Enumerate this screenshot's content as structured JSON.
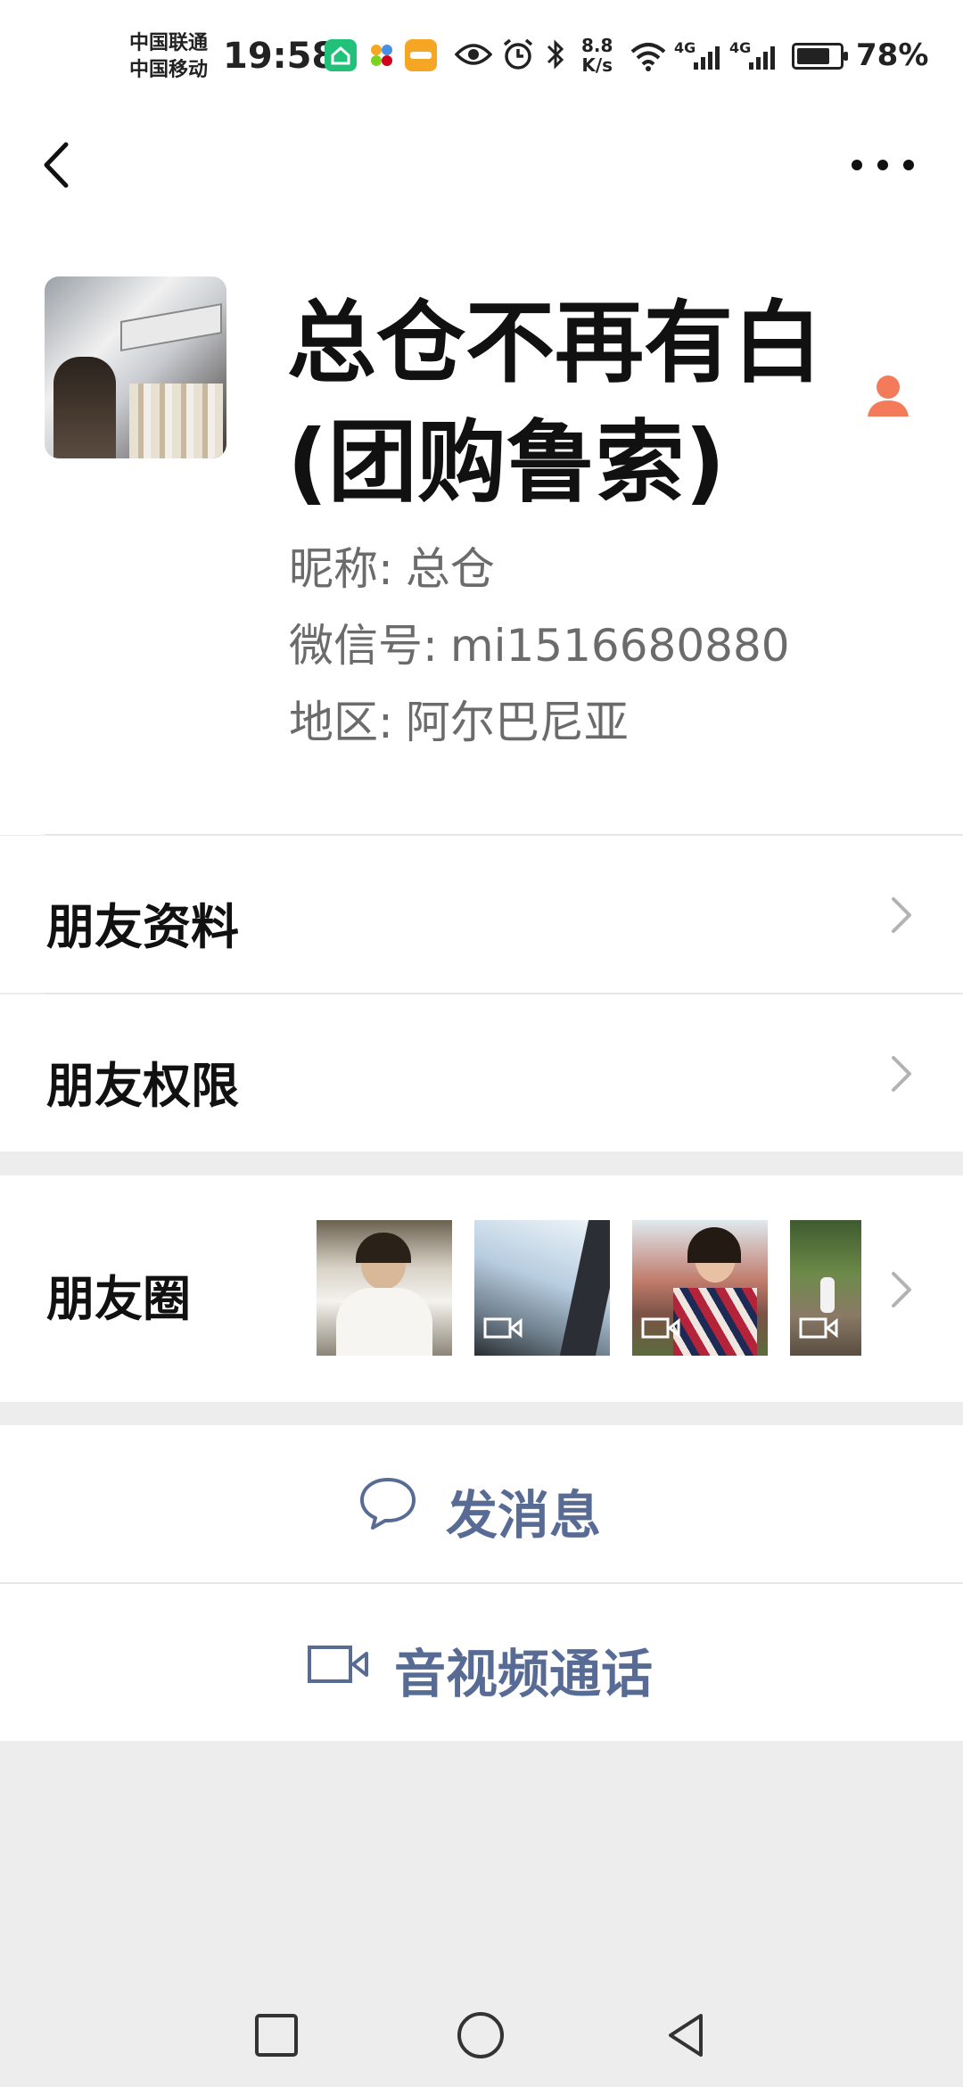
{
  "status_bar": {
    "carrier_1": "中国联通",
    "carrier_2": "中国移动",
    "time": "19:58",
    "net_speed_value": "8.8",
    "net_speed_unit": "K/s",
    "signal_1": "4G",
    "signal_2": "4G",
    "battery": "78%",
    "battery_level": 0.78,
    "icons": [
      "home-app-icon",
      "palette-app-icon",
      "imou-app-icon",
      "eye-icon",
      "alarm-icon",
      "bluetooth-icon",
      "wifi-icon",
      "signal-icon",
      "battery-icon"
    ]
  },
  "header": {
    "back_icon": "chevron-left-icon",
    "more_icon": "more-dots-icon"
  },
  "profile": {
    "name_line_1": "总仓不再有白",
    "name_line_2": "(团购鲁索)",
    "nickname_label": "昵称:",
    "nickname": "总仓",
    "wechat_id_label": "微信号:",
    "wechat_id": "mi1516680880",
    "region_label": "地区:",
    "region": "阿尔巴尼亚",
    "gender_icon": "female-icon",
    "gender_color": "#f37b5a"
  },
  "menu": {
    "friend_info": "朋友资料",
    "friend_permissions": "朋友权限",
    "moments": "朋友圈"
  },
  "moments_thumbs": [
    {
      "name": "moments-photo",
      "is_video": false
    },
    {
      "name": "moments-video",
      "is_video": true
    },
    {
      "name": "moments-video",
      "is_video": true
    },
    {
      "name": "moments-video",
      "is_video": true
    }
  ],
  "actions": {
    "send_message": "发消息",
    "video_call": "音视频通话",
    "accent_color": "#576b95"
  },
  "nav_bar": {
    "icons": [
      "recents-square-icon",
      "home-circle-icon",
      "back-triangle-icon"
    ]
  }
}
